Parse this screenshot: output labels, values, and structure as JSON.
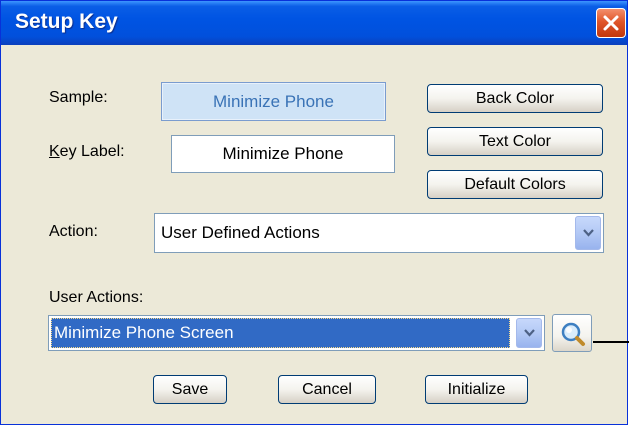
{
  "window": {
    "title": "Setup Key"
  },
  "form": {
    "sample_label": "Sample:",
    "sample_value": "Minimize Phone",
    "key_label_prefix": "K",
    "key_label_rest": "ey Label:",
    "key_label_value": "Minimize Phone",
    "action_label": "Action:",
    "action_value": "User Defined Actions",
    "user_actions_label": "User Actions:",
    "user_actions_value": "Minimize Phone Screen"
  },
  "buttons": {
    "back_color": "Back Color",
    "text_color": "Text Color",
    "default_colors": "Default Colors",
    "save": "Save",
    "cancel": "Cancel",
    "initialize": "Initialize"
  },
  "icons": {
    "close": "close-icon",
    "dropdown": "chevron-down-icon",
    "search": "magnifier-icon"
  },
  "colors": {
    "titlebar": "#0054e3",
    "close_button": "#e0562a",
    "selection": "#316ac5",
    "sample_background": "#cfe3f6",
    "sample_text": "#3a73b6"
  }
}
